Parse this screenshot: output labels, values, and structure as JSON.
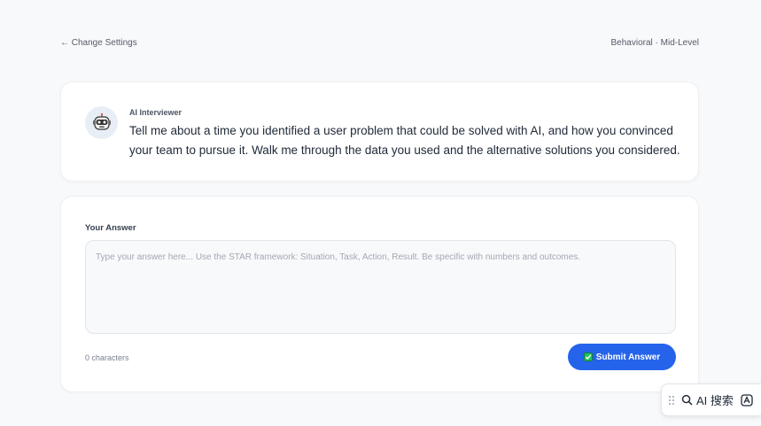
{
  "header": {
    "back_label": "← Change Settings",
    "session_meta": "Behavioral · Mid-Level"
  },
  "question": {
    "interviewer": "AI Interviewer",
    "text": "Tell me about a time you identified a user problem that could be solved with AI, and how you convinced your team to pursue it. Walk me through the data you used and the alternative solutions you considered.",
    "avatar_icon": "robot-icon"
  },
  "answer": {
    "label": "Your Answer",
    "value": "",
    "placeholder": "Type your answer here... Use the STAR framework: Situation, Task, Action, Result. Be specific with numbers and outcomes.",
    "char_count": "0 characters",
    "submit_label": "Submit Answer",
    "submit_icon": "check-icon"
  },
  "widget": {
    "search_label": "AI 搜索",
    "search_icon": "search-icon",
    "extra_icon": "translate-icon"
  },
  "colors": {
    "primary": "#2563eb",
    "background": "#f8f9fb",
    "card": "#ffffff"
  }
}
